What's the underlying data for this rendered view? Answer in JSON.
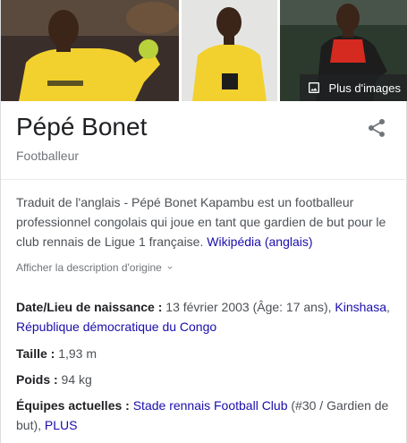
{
  "photos": {
    "more_images_label": "Plus d'images",
    "colors": {
      "jersey_yellow": "#f2d12e",
      "kit_red": "#d42a1f",
      "kit_black": "#1d1d1d",
      "glove_green": "#b7d23a"
    }
  },
  "header": {
    "title": "Pépé Bonet",
    "subtitle": "Footballeur",
    "share_icon": "share-icon"
  },
  "description": {
    "text": "Traduit de l'anglais - Pépé Bonet Kapambu est un footballeur professionnel congolais qui joue en tant que gardien de but pour le club rennais de Ligue 1 française. ",
    "source_link": "Wikipédia (anglais)",
    "show_original": "Afficher la description d'origine"
  },
  "facts": {
    "birth": {
      "label": "Date/Lieu de naissance :",
      "value": " 13 février 2003 (Âge: 17 ans), ",
      "place_link_1": "Kinshasa",
      "sep": ", ",
      "place_link_2": "République démocratique du Congo"
    },
    "height": {
      "label": "Taille :",
      "value": " 1,93 m"
    },
    "weight": {
      "label": "Poids :",
      "value": " 94 kg"
    },
    "teams": {
      "label": "Équipes actuelles :",
      "link": "Stade rennais Football Club",
      "value": " (#30 / Gardien de but), ",
      "more_link": "PLUS"
    }
  }
}
